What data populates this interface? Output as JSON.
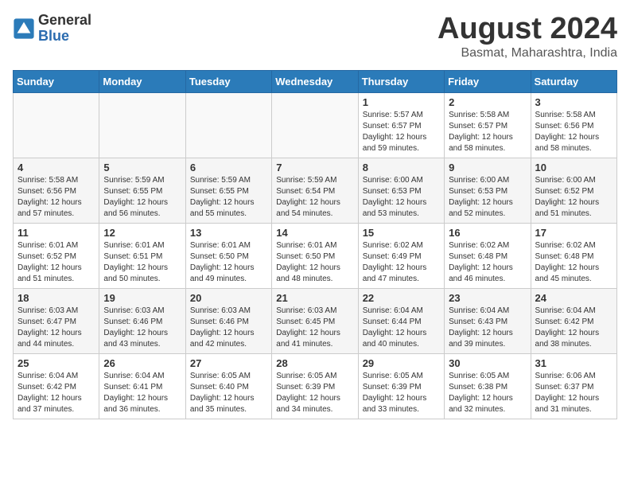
{
  "logo": {
    "general": "General",
    "blue": "Blue"
  },
  "title": {
    "month_year": "August 2024",
    "location": "Basmat, Maharashtra, India"
  },
  "weekdays": [
    "Sunday",
    "Monday",
    "Tuesday",
    "Wednesday",
    "Thursday",
    "Friday",
    "Saturday"
  ],
  "weeks": [
    [
      {
        "day": "",
        "info": ""
      },
      {
        "day": "",
        "info": ""
      },
      {
        "day": "",
        "info": ""
      },
      {
        "day": "",
        "info": ""
      },
      {
        "day": "1",
        "info": "Sunrise: 5:57 AM\nSunset: 6:57 PM\nDaylight: 12 hours\nand 59 minutes."
      },
      {
        "day": "2",
        "info": "Sunrise: 5:58 AM\nSunset: 6:57 PM\nDaylight: 12 hours\nand 58 minutes."
      },
      {
        "day": "3",
        "info": "Sunrise: 5:58 AM\nSunset: 6:56 PM\nDaylight: 12 hours\nand 58 minutes."
      }
    ],
    [
      {
        "day": "4",
        "info": "Sunrise: 5:58 AM\nSunset: 6:56 PM\nDaylight: 12 hours\nand 57 minutes."
      },
      {
        "day": "5",
        "info": "Sunrise: 5:59 AM\nSunset: 6:55 PM\nDaylight: 12 hours\nand 56 minutes."
      },
      {
        "day": "6",
        "info": "Sunrise: 5:59 AM\nSunset: 6:55 PM\nDaylight: 12 hours\nand 55 minutes."
      },
      {
        "day": "7",
        "info": "Sunrise: 5:59 AM\nSunset: 6:54 PM\nDaylight: 12 hours\nand 54 minutes."
      },
      {
        "day": "8",
        "info": "Sunrise: 6:00 AM\nSunset: 6:53 PM\nDaylight: 12 hours\nand 53 minutes."
      },
      {
        "day": "9",
        "info": "Sunrise: 6:00 AM\nSunset: 6:53 PM\nDaylight: 12 hours\nand 52 minutes."
      },
      {
        "day": "10",
        "info": "Sunrise: 6:00 AM\nSunset: 6:52 PM\nDaylight: 12 hours\nand 51 minutes."
      }
    ],
    [
      {
        "day": "11",
        "info": "Sunrise: 6:01 AM\nSunset: 6:52 PM\nDaylight: 12 hours\nand 51 minutes."
      },
      {
        "day": "12",
        "info": "Sunrise: 6:01 AM\nSunset: 6:51 PM\nDaylight: 12 hours\nand 50 minutes."
      },
      {
        "day": "13",
        "info": "Sunrise: 6:01 AM\nSunset: 6:50 PM\nDaylight: 12 hours\nand 49 minutes."
      },
      {
        "day": "14",
        "info": "Sunrise: 6:01 AM\nSunset: 6:50 PM\nDaylight: 12 hours\nand 48 minutes."
      },
      {
        "day": "15",
        "info": "Sunrise: 6:02 AM\nSunset: 6:49 PM\nDaylight: 12 hours\nand 47 minutes."
      },
      {
        "day": "16",
        "info": "Sunrise: 6:02 AM\nSunset: 6:48 PM\nDaylight: 12 hours\nand 46 minutes."
      },
      {
        "day": "17",
        "info": "Sunrise: 6:02 AM\nSunset: 6:48 PM\nDaylight: 12 hours\nand 45 minutes."
      }
    ],
    [
      {
        "day": "18",
        "info": "Sunrise: 6:03 AM\nSunset: 6:47 PM\nDaylight: 12 hours\nand 44 minutes."
      },
      {
        "day": "19",
        "info": "Sunrise: 6:03 AM\nSunset: 6:46 PM\nDaylight: 12 hours\nand 43 minutes."
      },
      {
        "day": "20",
        "info": "Sunrise: 6:03 AM\nSunset: 6:46 PM\nDaylight: 12 hours\nand 42 minutes."
      },
      {
        "day": "21",
        "info": "Sunrise: 6:03 AM\nSunset: 6:45 PM\nDaylight: 12 hours\nand 41 minutes."
      },
      {
        "day": "22",
        "info": "Sunrise: 6:04 AM\nSunset: 6:44 PM\nDaylight: 12 hours\nand 40 minutes."
      },
      {
        "day": "23",
        "info": "Sunrise: 6:04 AM\nSunset: 6:43 PM\nDaylight: 12 hours\nand 39 minutes."
      },
      {
        "day": "24",
        "info": "Sunrise: 6:04 AM\nSunset: 6:42 PM\nDaylight: 12 hours\nand 38 minutes."
      }
    ],
    [
      {
        "day": "25",
        "info": "Sunrise: 6:04 AM\nSunset: 6:42 PM\nDaylight: 12 hours\nand 37 minutes."
      },
      {
        "day": "26",
        "info": "Sunrise: 6:04 AM\nSunset: 6:41 PM\nDaylight: 12 hours\nand 36 minutes."
      },
      {
        "day": "27",
        "info": "Sunrise: 6:05 AM\nSunset: 6:40 PM\nDaylight: 12 hours\nand 35 minutes."
      },
      {
        "day": "28",
        "info": "Sunrise: 6:05 AM\nSunset: 6:39 PM\nDaylight: 12 hours\nand 34 minutes."
      },
      {
        "day": "29",
        "info": "Sunrise: 6:05 AM\nSunset: 6:39 PM\nDaylight: 12 hours\nand 33 minutes."
      },
      {
        "day": "30",
        "info": "Sunrise: 6:05 AM\nSunset: 6:38 PM\nDaylight: 12 hours\nand 32 minutes."
      },
      {
        "day": "31",
        "info": "Sunrise: 6:06 AM\nSunset: 6:37 PM\nDaylight: 12 hours\nand 31 minutes."
      }
    ]
  ]
}
